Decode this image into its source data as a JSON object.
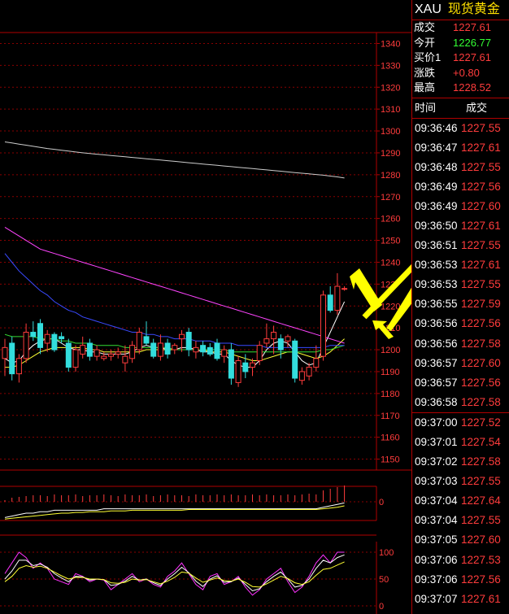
{
  "header": {
    "symbol": "XAU",
    "name": "现货黄金"
  },
  "quote": [
    {
      "label": "成交",
      "value": "1227.61",
      "color": "#ff3c3c"
    },
    {
      "label": "今开",
      "value": "1226.77",
      "color": "#33ff33"
    },
    {
      "label": "买价1",
      "value": "1227.61",
      "color": "#ff3c3c"
    },
    {
      "label": "涨跌",
      "value": "+0.80",
      "color": "#ff3c3c"
    },
    {
      "label": "最高",
      "value": "1228.52",
      "color": "#ff3c3c"
    }
  ],
  "ticks_header": {
    "time": "时间",
    "price": "成交"
  },
  "ticks": [
    {
      "time": "09:36:46",
      "price": "1227.55"
    },
    {
      "time": "09:36:47",
      "price": "1227.61"
    },
    {
      "time": "09:36:48",
      "price": "1227.55"
    },
    {
      "time": "09:36:49",
      "price": "1227.56"
    },
    {
      "time": "09:36:49",
      "price": "1227.60"
    },
    {
      "time": "09:36:50",
      "price": "1227.61"
    },
    {
      "time": "09:36:51",
      "price": "1227.55"
    },
    {
      "time": "09:36:53",
      "price": "1227.61"
    },
    {
      "time": "09:36:53",
      "price": "1227.55"
    },
    {
      "time": "09:36:55",
      "price": "1227.59"
    },
    {
      "time": "09:36:56",
      "price": "1227.56"
    },
    {
      "time": "09:36:56",
      "price": "1227.58"
    },
    {
      "time": "09:36:57",
      "price": "1227.60"
    },
    {
      "time": "09:36:57",
      "price": "1227.56"
    },
    {
      "time": "09:36:58",
      "price": "1227.58"
    },
    {
      "time": "09:37:00",
      "price": "1227.52"
    },
    {
      "time": "09:37:01",
      "price": "1227.54"
    },
    {
      "time": "09:37:02",
      "price": "1227.58"
    },
    {
      "time": "09:37:03",
      "price": "1227.55"
    },
    {
      "time": "09:37:04",
      "price": "1227.64"
    },
    {
      "time": "09:37:04",
      "price": "1227.55"
    },
    {
      "time": "09:37:05",
      "price": "1227.60"
    },
    {
      "time": "09:37:06",
      "price": "1227.53"
    },
    {
      "time": "09:37:06",
      "price": "1227.56"
    },
    {
      "time": "09:37:07",
      "price": "1227.61"
    }
  ],
  "chart_data": [
    {
      "type": "candlestick",
      "ylim": [
        1145,
        1345
      ],
      "yticks": [
        1340,
        1330,
        1320,
        1310,
        1300,
        1290,
        1280,
        1270,
        1260,
        1250,
        1240,
        1230,
        1220,
        1210,
        1200,
        1190,
        1180,
        1170,
        1160,
        1150
      ],
      "ytick_labels": [
        "1340",
        "1330",
        "1320",
        "1310",
        "1300",
        "1290",
        "1280",
        "1270",
        "1260",
        "1250",
        "1240",
        "123",
        "1220",
        "1210",
        "1200",
        "1190",
        "1180",
        "1170",
        "1160",
        "1150"
      ],
      "grid": true,
      "candles": [
        {
          "o": 1196,
          "h": 1205,
          "l": 1188,
          "c": 1201
        },
        {
          "o": 1203,
          "h": 1206,
          "l": 1186,
          "c": 1189
        },
        {
          "o": 1189,
          "h": 1198,
          "l": 1185,
          "c": 1196
        },
        {
          "o": 1196,
          "h": 1212,
          "l": 1194,
          "c": 1208
        },
        {
          "o": 1208,
          "h": 1213,
          "l": 1204,
          "c": 1206
        },
        {
          "o": 1212,
          "h": 1214,
          "l": 1198,
          "c": 1201
        },
        {
          "o": 1203,
          "h": 1209,
          "l": 1199,
          "c": 1207
        },
        {
          "o": 1207,
          "h": 1208,
          "l": 1199,
          "c": 1200
        },
        {
          "o": 1206,
          "h": 1208,
          "l": 1203,
          "c": 1205
        },
        {
          "o": 1203,
          "h": 1205,
          "l": 1190,
          "c": 1192
        },
        {
          "o": 1192,
          "h": 1202,
          "l": 1190,
          "c": 1200
        },
        {
          "o": 1198,
          "h": 1206,
          "l": 1196,
          "c": 1202
        },
        {
          "o": 1203,
          "h": 1205,
          "l": 1195,
          "c": 1197
        },
        {
          "o": 1197,
          "h": 1202,
          "l": 1195,
          "c": 1200
        },
        {
          "o": 1196,
          "h": 1199,
          "l": 1195,
          "c": 1197
        },
        {
          "o": 1197,
          "h": 1200,
          "l": 1195,
          "c": 1198
        },
        {
          "o": 1198,
          "h": 1201,
          "l": 1196,
          "c": 1199
        },
        {
          "o": 1194,
          "h": 1202,
          "l": 1190,
          "c": 1197
        },
        {
          "o": 1196,
          "h": 1204,
          "l": 1194,
          "c": 1202
        },
        {
          "o": 1200,
          "h": 1210,
          "l": 1198,
          "c": 1208
        },
        {
          "o": 1206,
          "h": 1213,
          "l": 1202,
          "c": 1203
        },
        {
          "o": 1203,
          "h": 1205,
          "l": 1196,
          "c": 1197
        },
        {
          "o": 1197,
          "h": 1207,
          "l": 1195,
          "c": 1203
        },
        {
          "o": 1203,
          "h": 1205,
          "l": 1196,
          "c": 1198
        },
        {
          "o": 1200,
          "h": 1203,
          "l": 1198,
          "c": 1202
        },
        {
          "o": 1205,
          "h": 1209,
          "l": 1199,
          "c": 1207
        },
        {
          "o": 1208,
          "h": 1210,
          "l": 1197,
          "c": 1200
        },
        {
          "o": 1199,
          "h": 1204,
          "l": 1196,
          "c": 1201
        },
        {
          "o": 1202,
          "h": 1204,
          "l": 1197,
          "c": 1199
        },
        {
          "o": 1201,
          "h": 1203,
          "l": 1197,
          "c": 1198
        },
        {
          "o": 1203,
          "h": 1205,
          "l": 1195,
          "c": 1196
        },
        {
          "o": 1197,
          "h": 1202,
          "l": 1194,
          "c": 1200
        },
        {
          "o": 1200,
          "h": 1203,
          "l": 1184,
          "c": 1187
        },
        {
          "o": 1185,
          "h": 1197,
          "l": 1183,
          "c": 1195
        },
        {
          "o": 1194,
          "h": 1198,
          "l": 1187,
          "c": 1190
        },
        {
          "o": 1192,
          "h": 1196,
          "l": 1188,
          "c": 1194
        },
        {
          "o": 1195,
          "h": 1204,
          "l": 1193,
          "c": 1202
        },
        {
          "o": 1203,
          "h": 1212,
          "l": 1201,
          "c": 1205
        },
        {
          "o": 1205,
          "h": 1211,
          "l": 1198,
          "c": 1208
        },
        {
          "o": 1205,
          "h": 1207,
          "l": 1196,
          "c": 1200
        },
        {
          "o": 1204,
          "h": 1207,
          "l": 1201,
          "c": 1206
        },
        {
          "o": 1204,
          "h": 1205,
          "l": 1185,
          "c": 1187
        },
        {
          "o": 1186,
          "h": 1192,
          "l": 1184,
          "c": 1190
        },
        {
          "o": 1188,
          "h": 1194,
          "l": 1186,
          "c": 1192
        },
        {
          "o": 1192,
          "h": 1202,
          "l": 1190,
          "c": 1196
        },
        {
          "o": 1197,
          "h": 1227,
          "l": 1195,
          "c": 1225
        },
        {
          "o": 1225,
          "h": 1229,
          "l": 1217,
          "c": 1218
        },
        {
          "o": 1218,
          "h": 1235,
          "l": 1216,
          "c": 1229
        },
        {
          "o": 1228,
          "h": 1229,
          "l": 1227,
          "c": 1228
        }
      ],
      "series": [
        {
          "color": "#ffffff",
          "values": [
            1196,
            1194,
            1195,
            1199,
            1202,
            1204,
            1205,
            1205,
            1203,
            1201,
            1200,
            1200,
            1199,
            1199,
            1198,
            1198,
            1198,
            1198,
            1199,
            1201,
            1202,
            1201,
            1201,
            1200,
            1200,
            1201,
            1201,
            1200,
            1199,
            1199,
            1198,
            1198,
            1195,
            1193,
            1192,
            1192,
            1195,
            1200,
            1203,
            1204,
            1203,
            1199,
            1195,
            1193,
            1194,
            1201,
            1208,
            1215,
            1222
          ]
        },
        {
          "color": "#ffff33",
          "values": [
            1192,
            1192,
            1193,
            1195,
            1197,
            1199,
            1200,
            1201,
            1201,
            1201,
            1201,
            1201,
            1200,
            1200,
            1199,
            1199,
            1199,
            1199,
            1199,
            1199,
            1200,
            1200,
            1200,
            1200,
            1200,
            1200,
            1200,
            1200,
            1200,
            1199,
            1199,
            1199,
            1198,
            1197,
            1196,
            1195,
            1195,
            1196,
            1197,
            1198,
            1199,
            1199,
            1198,
            1197,
            1196,
            1197,
            1199,
            1202,
            1205
          ]
        },
        {
          "color": "#33dd33",
          "values": [
            1207,
            1206,
            1206,
            1206,
            1206,
            1205,
            1205,
            1205,
            1204,
            1204,
            1203,
            1203,
            1203,
            1202,
            1202,
            1202,
            1202,
            1201,
            1201,
            1201,
            1201,
            1201,
            1201,
            1201,
            1200,
            1200,
            1200,
            1200,
            1200,
            1200,
            1200,
            1200,
            1199,
            1199,
            1199,
            1199,
            1199,
            1199,
            1199,
            1199,
            1199,
            1199,
            1199,
            1199,
            1199,
            1200,
            1200,
            1201,
            1202
          ]
        },
        {
          "color": "#3a4aff",
          "values": [
            1244,
            1240,
            1236,
            1233,
            1230,
            1227,
            1225,
            1222,
            1220,
            1218,
            1217,
            1215,
            1214,
            1213,
            1212,
            1211,
            1210,
            1209,
            1208,
            1208,
            1207,
            1207,
            1206,
            1206,
            1205,
            1205,
            1205,
            1204,
            1204,
            1204,
            1203,
            1203,
            1203,
            1202,
            1202,
            1202,
            1202,
            1201,
            1201,
            1201,
            1201,
            1201,
            1201,
            1201,
            1201,
            1201,
            1202,
            1202,
            1202
          ]
        },
        {
          "color": "#ff44ff",
          "values": [
            1256,
            1254,
            1252,
            1250,
            1248,
            1246,
            1245,
            1244,
            1243,
            1242,
            1241,
            1240,
            1239,
            1238,
            1237,
            1236,
            1235,
            1234,
            1233,
            1232,
            1231,
            1230,
            1229,
            1228,
            1227,
            1226,
            1225,
            1224,
            1223,
            1222,
            1221,
            1220,
            1219,
            1218,
            1217,
            1216,
            1215,
            1214,
            1213,
            1212,
            1211,
            1210,
            1209,
            1208,
            1207,
            1206,
            1205,
            1204,
            1203
          ]
        },
        {
          "color": "#cccccc",
          "values": [
            1295,
            1294.5,
            1294,
            1293.5,
            1293,
            1292.5,
            1292,
            1291.6,
            1291.2,
            1290.8,
            1290.4,
            1290,
            1289.7,
            1289.4,
            1289.1,
            1288.8,
            1288.5,
            1288.2,
            1287.9,
            1287.6,
            1287.3,
            1287,
            1286.7,
            1286.4,
            1286.1,
            1285.8,
            1285.5,
            1285.2,
            1284.9,
            1284.6,
            1284.3,
            1284,
            1283.7,
            1283.4,
            1283.1,
            1282.8,
            1282.5,
            1282.2,
            1281.9,
            1281.6,
            1281.3,
            1281,
            1280.7,
            1280.4,
            1280.1,
            1279.8,
            1279.4,
            1279,
            1278.5
          ]
        }
      ]
    },
    {
      "type": "bar",
      "yticks": [
        0
      ],
      "bars": [
        2,
        5,
        6,
        7,
        8,
        8,
        7,
        9,
        8,
        8,
        9,
        7,
        8,
        8,
        9,
        8,
        7,
        9,
        8,
        8,
        9,
        7,
        8,
        9,
        8,
        8,
        7,
        9,
        8,
        8,
        9,
        8,
        9,
        8,
        8,
        9,
        8,
        9,
        8,
        8,
        9,
        8,
        9,
        10,
        9,
        14,
        16,
        18,
        20
      ],
      "series": [
        {
          "color": "#ffffff",
          "values": [
            2,
            3,
            4,
            5,
            5,
            6,
            6,
            7,
            7,
            7,
            7,
            7,
            7,
            7,
            8,
            8,
            8,
            8,
            8,
            8,
            8,
            8,
            8,
            8,
            8,
            8,
            8,
            8,
            8,
            8,
            8,
            8,
            8,
            8,
            8,
            8,
            8,
            8,
            8,
            8,
            8,
            8,
            8,
            8,
            8,
            9,
            10,
            11,
            12
          ]
        },
        {
          "color": "#ffff33",
          "values": [
            1,
            1.5,
            2,
            2.5,
            3,
            3.5,
            4,
            4.5,
            5,
            5,
            5.5,
            5.5,
            6,
            6,
            6,
            6.5,
            6.5,
            6.5,
            7,
            7,
            7,
            7,
            7,
            7,
            7,
            7,
            7.5,
            7.5,
            7.5,
            7.5,
            7.5,
            7.5,
            7.5,
            7.5,
            7.5,
            7.5,
            7.5,
            7.5,
            7.5,
            7.5,
            7.5,
            7.5,
            7.5,
            7.5,
            7.5,
            8,
            8.5,
            9,
            10
          ]
        }
      ]
    },
    {
      "type": "line",
      "ylim": [
        0,
        100
      ],
      "yticks": [
        100,
        50,
        0
      ],
      "series": [
        {
          "color": "#ff33ff",
          "values": [
            60,
            80,
            100,
            90,
            70,
            80,
            70,
            50,
            45,
            40,
            60,
            55,
            45,
            50,
            48,
            30,
            40,
            50,
            60,
            45,
            50,
            40,
            35,
            55,
            65,
            80,
            60,
            40,
            30,
            55,
            60,
            40,
            45,
            55,
            35,
            20,
            30,
            50,
            60,
            70,
            45,
            25,
            35,
            55,
            80,
            95,
            80,
            100,
            100
          ]
        },
        {
          "color": "#ffffff",
          "values": [
            50,
            65,
            85,
            85,
            75,
            78,
            72,
            60,
            52,
            45,
            55,
            54,
            48,
            50,
            49,
            38,
            40,
            46,
            55,
            48,
            50,
            43,
            38,
            50,
            60,
            72,
            62,
            46,
            36,
            50,
            56,
            44,
            45,
            52,
            40,
            28,
            32,
            45,
            55,
            63,
            50,
            35,
            38,
            50,
            70,
            85,
            80,
            90,
            95
          ]
        },
        {
          "color": "#ffff33",
          "values": [
            45,
            55,
            70,
            75,
            72,
            74,
            70,
            63,
            56,
            50,
            53,
            53,
            50,
            50,
            49,
            43,
            42,
            44,
            50,
            48,
            49,
            45,
            41,
            46,
            53,
            63,
            61,
            52,
            44,
            48,
            52,
            47,
            46,
            50,
            44,
            36,
            35,
            41,
            48,
            55,
            51,
            43,
            40,
            45,
            57,
            68,
            70,
            76,
            82
          ]
        }
      ]
    }
  ]
}
